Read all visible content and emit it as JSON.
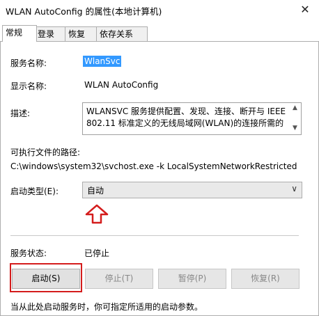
{
  "window": {
    "title": "WLAN AutoConfig 的属性(本地计算机)",
    "close_glyph": "✕"
  },
  "tabs": [
    {
      "label": "常规",
      "active": true
    },
    {
      "label": "登录",
      "active": false
    },
    {
      "label": "恢复",
      "active": false
    },
    {
      "label": "依存关系",
      "active": false
    }
  ],
  "general": {
    "service_name_label": "服务名称:",
    "service_name": "WlanSvc",
    "display_name_label": "显示名称:",
    "display_name": "WLAN AutoConfig",
    "description_label": "描述:",
    "description": "WLANSVC 服务提供配置、发现、连接、断开与 IEEE 802.11 标准定义的无线局域网(WLAN)的连接所需的",
    "exe_path_label": "可执行文件的路径:",
    "exe_path": "C:\\windows\\system32\\svchost.exe -k LocalSystemNetworkRestricted",
    "startup_type_label": "启动类型(E):",
    "startup_type": "自动",
    "status_label": "服务状态:",
    "status": "已停止",
    "buttons": {
      "start": "启动(S)",
      "stop": "停止(T)",
      "pause": "暂停(P)",
      "resume": "恢复(R)"
    },
    "footer": "当从此处启动服务时，你可指定所适用的启动参数。"
  },
  "colors": {
    "highlight": "#3399ff",
    "annotation_red": "#d41c1c"
  }
}
